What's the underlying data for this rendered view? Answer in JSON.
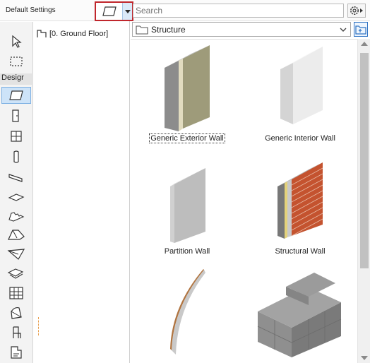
{
  "topbar": {
    "default_settings": "Default Settings",
    "search_placeholder": "Search",
    "search_value": ""
  },
  "toolbox": {
    "section_label": "Desigr",
    "active_tool": "wall",
    "tools": [
      "arrow",
      "marquee",
      "wall",
      "door",
      "window",
      "column",
      "beam",
      "slab",
      "stair",
      "roof",
      "shell",
      "mesh",
      "curtain-wall",
      "morph",
      "object",
      "zone"
    ]
  },
  "tree": {
    "story_label": "[0. Ground Floor]"
  },
  "library": {
    "folder": "Structure",
    "items": [
      {
        "label": "Generic Exterior Wall",
        "selected": true
      },
      {
        "label": "Generic Interior Wall",
        "selected": false
      },
      {
        "label": "Partition Wall",
        "selected": false
      },
      {
        "label": "Structural Wall",
        "selected": false
      },
      {
        "label": "",
        "selected": false
      },
      {
        "label": "",
        "selected": false
      }
    ]
  },
  "colors": {
    "accent_red": "#c0262c",
    "selection_blue": "#cde3f8",
    "brick": "#c4532f"
  }
}
